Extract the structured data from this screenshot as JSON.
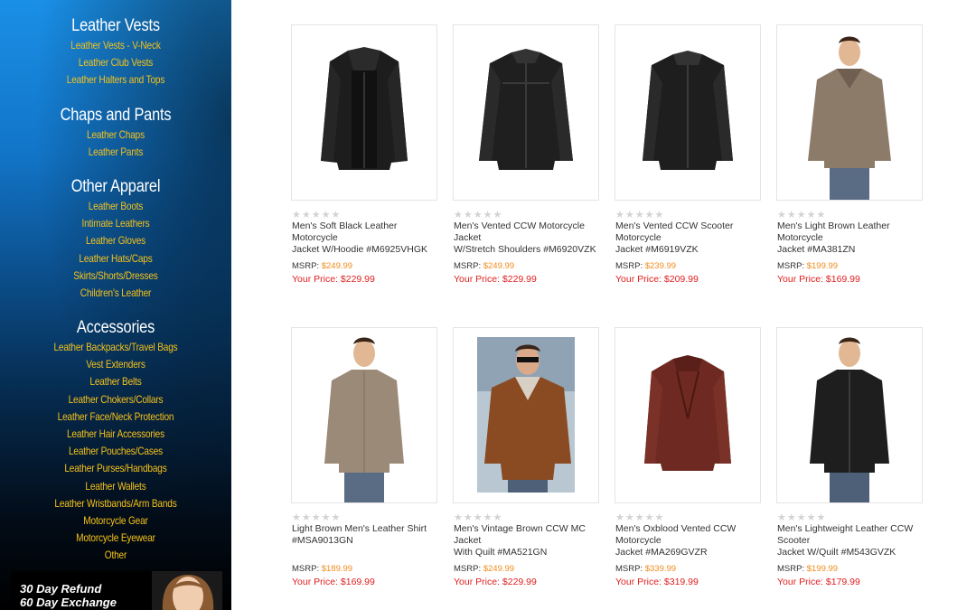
{
  "sidebar": {
    "sections": [
      {
        "heading": "Leather Vests",
        "items": [
          "Leather Vests - V-Neck",
          "Leather Club Vests",
          "Leather Halters and Tops"
        ]
      },
      {
        "heading": "Chaps and Pants",
        "items": [
          "Leather Chaps",
          "Leather Pants"
        ]
      },
      {
        "heading": "Other Apparel",
        "items": [
          "Leather Boots",
          "Intimate Leathers",
          "Leather Gloves",
          "Leather Hats/Caps",
          "Skirts/Shorts/Dresses",
          "Children's Leather"
        ]
      },
      {
        "heading": "Accessories",
        "items": [
          "Leather Backpacks/Travel Bags",
          "Vest Extenders",
          "Leather Belts",
          "Leather Chokers/Collars",
          "Leather Face/Neck Protection",
          "Leather Hair Accessories",
          "Leather Pouches/Cases",
          "Leather Purses/Handbags",
          "Leather Wallets",
          "Leather Wristbands/Arm Bands",
          "Motorcycle Gear",
          "Motorcycle Eyewear",
          "Other"
        ]
      }
    ],
    "promo": {
      "line1": "30 Day Refund",
      "line2": "60 Day Exchange"
    }
  },
  "products": [
    {
      "name_line1": "Men's Soft Black Leather Motorcycle",
      "name_line2": "Jacket W/Hoodie #M6925VHGK",
      "msrp_label": "MSRP:",
      "msrp": "$249.99",
      "price_label": "Your Price:",
      "price": "$229.99",
      "image": "black-hoodie-jacket"
    },
    {
      "name_line1": "Men's Vented CCW Motorcycle Jacket",
      "name_line2": "W/Stretch Shoulders #M6920VZK",
      "msrp_label": "MSRP:",
      "msrp": "$249.99",
      "price_label": "Your Price:",
      "price": "$229.99",
      "image": "black-jacket"
    },
    {
      "name_line1": "Men's Vented CCW Scooter Motorcycle",
      "name_line2": "Jacket #M6919VZK",
      "msrp_label": "MSRP:",
      "msrp": "$239.99",
      "price_label": "Your Price:",
      "price": "$209.99",
      "image": "black-scooter-jacket"
    },
    {
      "name_line1": "Men's Light Brown Leather Motorcycle",
      "name_line2": "Jacket #MA381ZN",
      "msrp_label": "MSRP:",
      "msrp": "$199.99",
      "price_label": "Your Price:",
      "price": "$169.99",
      "image": "light-brown-jacket-model"
    },
    {
      "name_line1": "Light Brown Men's Leather Shirt",
      "name_line2": "#MSA9013GN",
      "msrp_label": "MSRP:",
      "msrp": "$189.99",
      "price_label": "Your Price:",
      "price": "$169.99",
      "image": "brown-shirt-model"
    },
    {
      "name_line1": "Men's Vintage Brown CCW MC Jacket",
      "name_line2": "With Quilt #MA521GN",
      "msrp_label": "MSRP:",
      "msrp": "$249.99",
      "price_label": "Your Price:",
      "price": "$229.99",
      "image": "vintage-brown-jacket-model"
    },
    {
      "name_line1": "Men's Oxblood Vented CCW Motorcycle",
      "name_line2": "Jacket #MA269GVZR",
      "msrp_label": "MSRP:",
      "msrp": "$339.99",
      "price_label": "Your Price:",
      "price": "$319.99",
      "image": "oxblood-jacket"
    },
    {
      "name_line1": "Men's Lightweight Leather CCW Scooter",
      "name_line2": "Jacket W/Quilt #M543GVZK",
      "msrp_label": "MSRP:",
      "msrp": "$199.99",
      "price_label": "Your Price:",
      "price": "$179.99",
      "image": "black-jacket-model"
    }
  ],
  "colors": {
    "nav_link": "#f6c21a",
    "msrp_value": "#f08b1c",
    "price": "#e02020"
  }
}
